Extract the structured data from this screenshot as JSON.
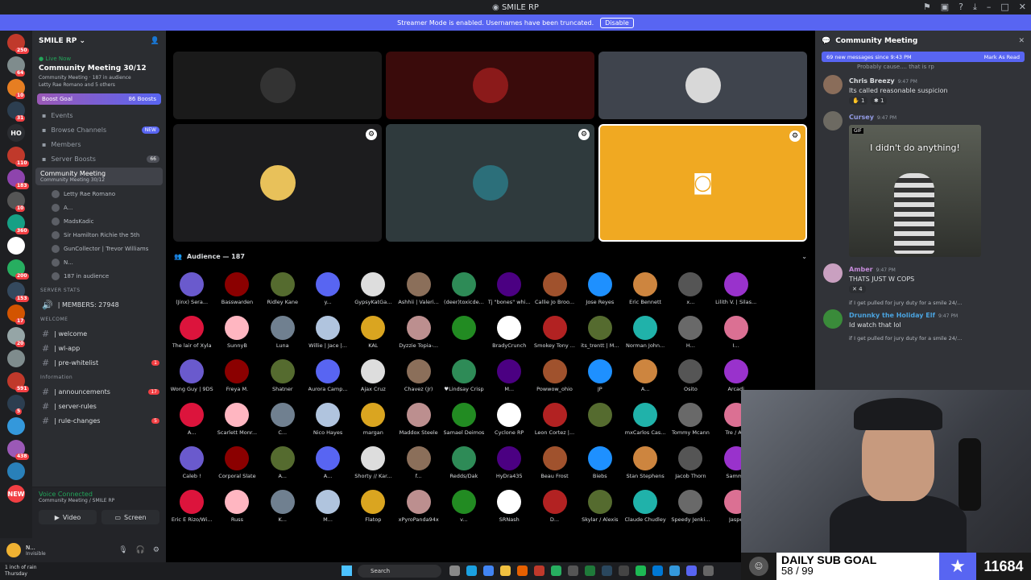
{
  "window": {
    "title": "SMILE RP"
  },
  "banner": {
    "text": "Streamer Mode is enabled. Usernames have been truncated.",
    "button": "Disable"
  },
  "rail": [
    {
      "badge": "250",
      "color": "#c0392b"
    },
    {
      "badge": "64",
      "color": "#7f8c8d"
    },
    {
      "badge": "10",
      "color": "#e67e22"
    },
    {
      "badge": "31",
      "color": "#2c3e50"
    },
    {
      "label": "HO",
      "badge": "",
      "color": "#2b2d31"
    },
    {
      "badge": "110",
      "color": "#c0392b"
    },
    {
      "badge": "183",
      "color": "#8e44ad"
    },
    {
      "badge": "10",
      "color": "#555"
    },
    {
      "badge": "360",
      "color": "#16a085"
    },
    {
      "badge": "",
      "color": "#fff"
    },
    {
      "badge": "200",
      "color": "#27ae60"
    },
    {
      "badge": "153",
      "color": "#34495e"
    },
    {
      "badge": "17",
      "color": "#d35400"
    },
    {
      "badge": "20",
      "color": "#95a5a6"
    },
    {
      "badge": "",
      "color": "#7f8c8d"
    },
    {
      "badge": "591",
      "color": "#c0392b"
    },
    {
      "badge": "5",
      "color": "#2c3e50"
    },
    {
      "badge": "",
      "color": "#3498db"
    },
    {
      "badge": "438",
      "color": "#9b59b6"
    },
    {
      "badge": "",
      "color": "#2980b9"
    },
    {
      "label": "NEW",
      "badge": "",
      "color": "#f23f43"
    }
  ],
  "sidebar": {
    "server_name": "SMILE RP",
    "live_now": "Live Now",
    "event_title": "Community Meeting 30/12",
    "event_channel": "Community Meeting",
    "event_audience": "187 in audience",
    "event_people": "Letty Rae Romano and 5 others",
    "boost_goal": "Boost Goal",
    "boosts": "86 Boosts",
    "nav": [
      {
        "label": "Events",
        "tag": ""
      },
      {
        "label": "Browse Channels",
        "tag": "NEW"
      },
      {
        "label": "Members",
        "tag": ""
      },
      {
        "label": "Server Boosts",
        "tag": "66"
      }
    ],
    "active_channel": {
      "name": "Community Meeting",
      "sub": "Community Meeting 30/12"
    },
    "voice_users": [
      "Letty Rae Romano",
      "A...",
      "MadsKadic",
      "Sir Hamilton Richie the 5th",
      "GunCollector | Trevor Williams",
      "N...",
      "187 in audience"
    ],
    "categories": {
      "stats": "SERVER STATS",
      "members": "| MEMBERS: 27948",
      "welcome": "WELCOME",
      "information": "Information"
    },
    "channels_welcome": [
      {
        "name": "| welcome",
        "count": ""
      },
      {
        "name": "| wl-app",
        "count": ""
      },
      {
        "name": "| pre-whitelist",
        "count": "1"
      }
    ],
    "channels_info": [
      {
        "name": "| announcements",
        "count": "17"
      },
      {
        "name": "| server-rules",
        "count": ""
      },
      {
        "name": "| rule-changes",
        "count": "5"
      }
    ],
    "voice": {
      "title": "Voice Connected",
      "sub": "Community Meeting / SMILE RP",
      "video": "Video",
      "screen": "Screen"
    },
    "user": {
      "name": "N...",
      "status": "Invisible"
    }
  },
  "stage": {
    "audience_label": "Audience — 187",
    "audience": [
      "(Jinx) Sera...",
      "Basswarden",
      "Ridley Kane",
      "y...",
      "GypsyKatGa...",
      "Ashhii | Valeri...",
      "(deer)toxicde...",
      "Tj \"bones\" whi...",
      "Callie Jo Broo...",
      "Jose Reyes",
      "Eric Bennett",
      "x...",
      "Lilith V. | Silas...",
      "The lair of Xyla",
      "SunnyB",
      "Luna",
      "Willie | Jace |...",
      "KAL",
      "Dyzzie Topia-...",
      "",
      "BradyCrunch",
      "Smokey Tony ...",
      "its_trentt | M...",
      "Norman John...",
      "H...",
      "I...",
      "Wong Guy | 9DS",
      "Freya M.",
      "Shatner",
      "Aurora Camp...",
      "Ajax Cruz",
      "Chavez (Jr)",
      "♥Lindsay Crisp",
      "M...",
      "Powwow_ohio",
      "JP",
      "A...",
      "Osito",
      "Arcadi",
      "A...",
      "Scarlett Monr...",
      "C...",
      "Nico Hayes",
      "margan",
      "Maddox Steele",
      "Samael Deimos",
      "Cyclone RP",
      "Leon Cortez |...",
      "",
      "mxCarlos Cas...",
      "Tommy Mcann",
      "Tre / Am",
      "Caleb !",
      "Corporal Slate",
      "A...",
      "A...",
      "Shorty // Kar...",
      "f...",
      "Redds/Dak",
      "HyDra435",
      "Beau Frost",
      "Biebs",
      "Stan Stephens",
      "Jacob Thorn",
      "Sammy",
      "Eric E Rizo/Wi...",
      "Russ",
      "K...",
      "M...",
      "Flatop",
      "xPyroPanda94x",
      "v...",
      "SRNash",
      "D...",
      "Skylar / Alexis",
      "Claude Chudley",
      "Speedy Jenki...",
      "Jaspe"
    ]
  },
  "chat": {
    "title": "Community Meeting",
    "new_messages": "69 new messages since 9:43 PM",
    "mark_read": "Mark As Read",
    "messages": [
      {
        "author": "Chris Breezy",
        "time": "9:47 PM",
        "text": "Its called reasonable suspicion",
        "color": "#dbdee1"
      },
      {
        "author": "Cursey",
        "time": "9:47 PM",
        "text": "",
        "color": "#949ce5",
        "gif": "I didn't do anything!"
      },
      {
        "author": "Amber",
        "time": "9:47 PM",
        "text": "THATS JUST W COPS",
        "color": "#c48bd9"
      },
      {
        "author": "Drunnky the Holiday Elf",
        "time": "9:47 PM",
        "text": "Id watch that lol",
        "color": "#4aa3df"
      }
    ],
    "reply_preview": "if I get pulled for jury duty for a smile 24/...",
    "top_text": "Probably cause.... that is rp"
  },
  "overlay": {
    "goal_title": "DAILY SUB GOAL",
    "goal_progress": "58 / 99",
    "count": "11684"
  },
  "taskbar": {
    "weather_line1": "1 inch of rain",
    "weather_line2": "Thursday",
    "search": "Search"
  }
}
